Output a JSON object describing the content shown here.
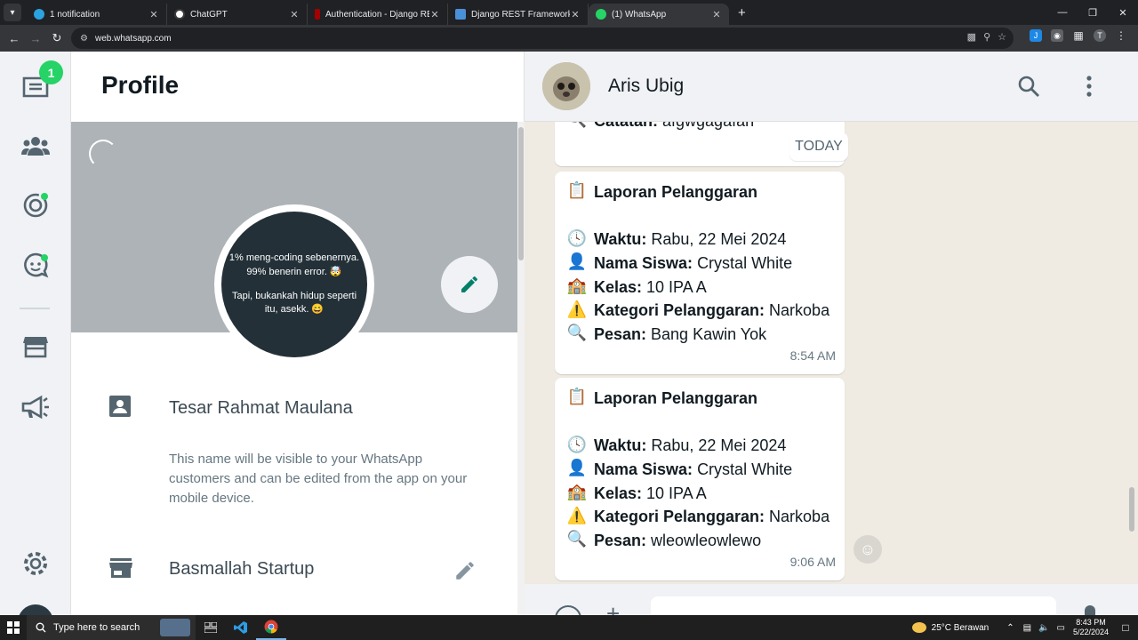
{
  "browser": {
    "tabs": [
      {
        "label": "1 notification",
        "color": "#2aa3e0"
      },
      {
        "label": "ChatGPT",
        "color": "#3c3c3c"
      },
      {
        "label": "Authentication - Django REST f...",
        "color": "#a30000"
      },
      {
        "label": "Django REST Framework Authe...",
        "color": "#4a90d9"
      },
      {
        "label": "(1) WhatsApp",
        "color": "#25d366"
      }
    ],
    "new_tab": "+",
    "url": "web.whatsapp.com"
  },
  "rail": {
    "unread_badge": "1"
  },
  "profile": {
    "title": "Profile",
    "about_lines": [
      "1% meng-coding sebenernya.",
      "99% benerin error. 🤯",
      "",
      "Tapi, bukankah hidup seperti",
      "itu, asekk. 😄"
    ],
    "name": "Tesar Rahmat Maulana",
    "name_note": "This name will be visible to your WhatsApp customers and can be edited from the app on your mobile device.",
    "business": "Basmallah Startup"
  },
  "chat": {
    "contact_name": "Aris Ubig",
    "partial_msg": {
      "label": "Catatan:",
      "value": "afgwgagafan"
    },
    "date_divider": "TODAY",
    "messages": [
      {
        "title": "Laporan Pelanggaran",
        "waktu_label": "Waktu:",
        "waktu": "Rabu, 22 Mei 2024",
        "nama_label": "Nama Siswa:",
        "nama": "Crystal White",
        "kelas_label": "Kelas:",
        "kelas": "10 IPA A",
        "kategori_label": "Kategori Pelanggaran:",
        "kategori": "Narkoba",
        "pesan_label": "Pesan:",
        "pesan": "Bang Kawin Yok",
        "time": "8:54 AM"
      },
      {
        "title": "Laporan Pelanggaran",
        "waktu_label": "Waktu:",
        "waktu": "Rabu, 22 Mei 2024",
        "nama_label": "Nama Siswa:",
        "nama": "Crystal White",
        "kelas_label": "Kelas:",
        "kelas": "10 IPA A",
        "kategori_label": "Kategori Pelanggaran:",
        "kategori": "Narkoba",
        "pesan_label": "Pesan:",
        "pesan": "wleowleowlewo",
        "time": "9:06 AM"
      }
    ]
  },
  "taskbar": {
    "search_placeholder": "Type here to search",
    "weather": "25°C  Berawan",
    "time": "8:43 PM",
    "date": "5/22/2024"
  },
  "colors": {
    "accent": "#25d366",
    "teal": "#008069"
  }
}
